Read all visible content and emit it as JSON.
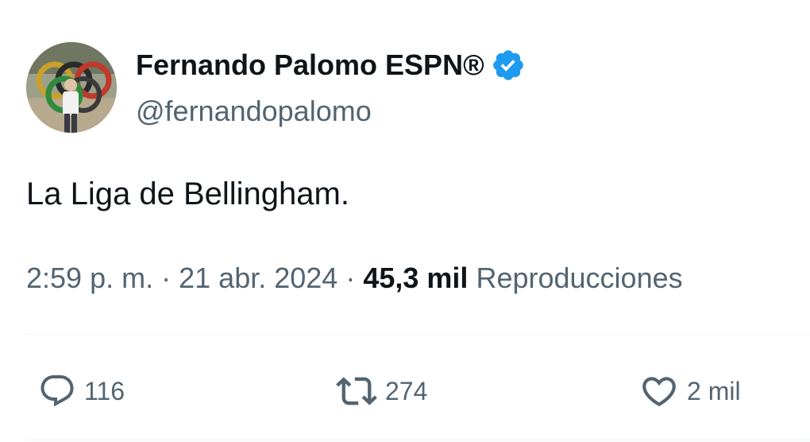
{
  "author": {
    "name": "Fernando Palomo ESPN®",
    "handle": "@fernandopalomo",
    "verified_color": "#1d9bf0"
  },
  "tweet": {
    "text": "La Liga de Bellingham."
  },
  "meta": {
    "time": "2:59 p. m.",
    "separator": "·",
    "date": "21 abr. 2024",
    "views_count": "45,3 mil",
    "views_label": "Reproducciones"
  },
  "actions": {
    "replies": {
      "icon": "reply-icon",
      "count": "116"
    },
    "reposts": {
      "icon": "repost-icon",
      "count": "274"
    },
    "likes": {
      "icon": "heart-icon",
      "count": "2 mil"
    }
  },
  "colors": {
    "text_primary": "#0f1419",
    "text_secondary": "#536471",
    "divider": "#eff3f4",
    "verified": "#1d9bf0"
  }
}
